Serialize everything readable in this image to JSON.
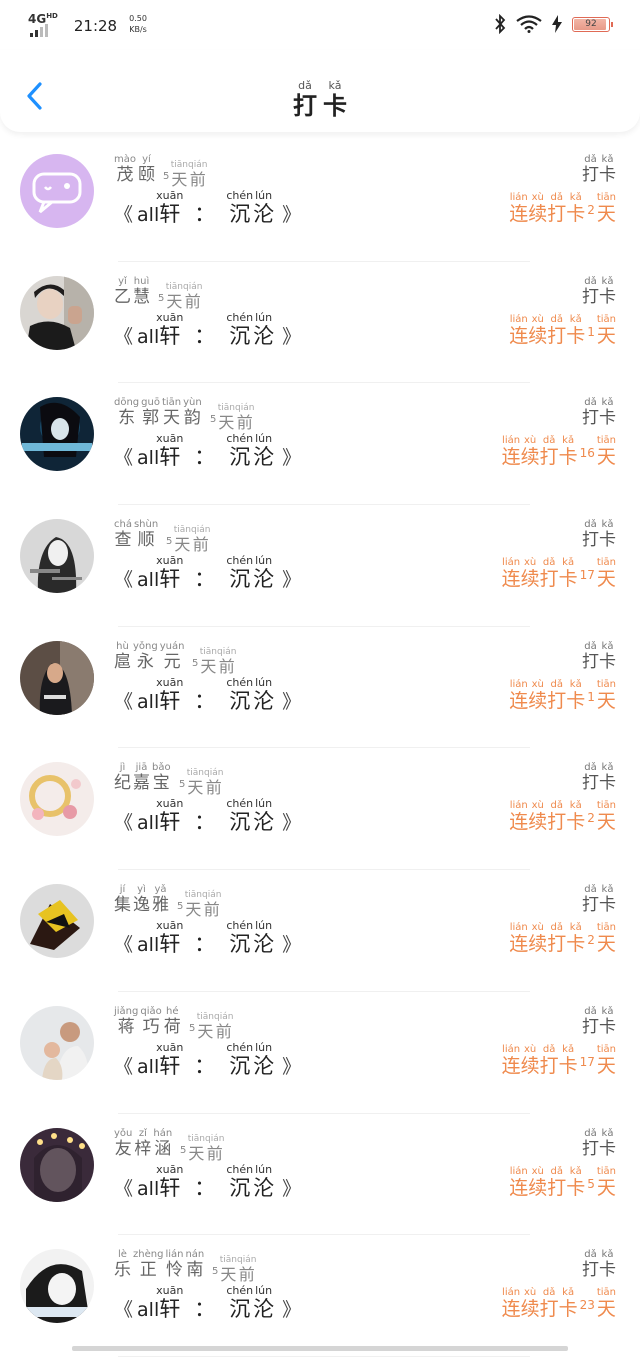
{
  "status_bar": {
    "network": "4G",
    "network_sup": "HD",
    "time": "21:28",
    "speed_value": "0.50",
    "speed_unit": "KB/s",
    "battery": "92"
  },
  "header": {
    "title": [
      {
        "char": "打",
        "pinyin": "dǎ"
      },
      {
        "char": "卡",
        "pinyin": "kǎ"
      }
    ],
    "icons": {
      "back": "chevron-left-icon"
    }
  },
  "rows": [
    {
      "avatar": "speech-bubble",
      "name": [
        {
          "char": "茂",
          "pinyin": "mào"
        },
        {
          "char": "颐",
          "pinyin": "yí"
        }
      ],
      "days": "5",
      "streak": "2"
    },
    {
      "avatar": "photo-man",
      "name": [
        {
          "char": "乙",
          "pinyin": "yǐ"
        },
        {
          "char": "慧",
          "pinyin": "huì"
        }
      ],
      "days": "5",
      "streak": "1"
    },
    {
      "avatar": "photo-anime",
      "name": [
        {
          "char": "东",
          "pinyin": "dōng"
        },
        {
          "char": "郭",
          "pinyin": "guō"
        },
        {
          "char": "天",
          "pinyin": "tiān"
        },
        {
          "char": "韵",
          "pinyin": "yùn"
        }
      ],
      "days": "5",
      "streak": "16"
    },
    {
      "avatar": "photo-girl-bw",
      "name": [
        {
          "char": "查",
          "pinyin": "chá"
        },
        {
          "char": "顺",
          "pinyin": "shùn"
        }
      ],
      "days": "5",
      "streak": "17"
    },
    {
      "avatar": "photo-girl-dark",
      "name": [
        {
          "char": "扈",
          "pinyin": "hù"
        },
        {
          "char": "永",
          "pinyin": "yǒng"
        },
        {
          "char": "元",
          "pinyin": "yuán"
        }
      ],
      "days": "5",
      "streak": "1"
    },
    {
      "avatar": "photo-bracelet",
      "name": [
        {
          "char": "纪",
          "pinyin": "jì"
        },
        {
          "char": "嘉",
          "pinyin": "jiā"
        },
        {
          "char": "宝",
          "pinyin": "bǎo"
        }
      ],
      "days": "5",
      "streak": "2"
    },
    {
      "avatar": "photo-gold",
      "name": [
        {
          "char": "集",
          "pinyin": "jí"
        },
        {
          "char": "逸",
          "pinyin": "yì"
        },
        {
          "char": "雅",
          "pinyin": "yǎ"
        }
      ],
      "days": "5",
      "streak": "2"
    },
    {
      "avatar": "photo-family",
      "name": [
        {
          "char": "蒋",
          "pinyin": "jiǎng"
        },
        {
          "char": "巧",
          "pinyin": "qiǎo"
        },
        {
          "char": "荷",
          "pinyin": "hé"
        }
      ],
      "days": "5",
      "streak": "17"
    },
    {
      "avatar": "photo-girl-lights",
      "name": [
        {
          "char": "友",
          "pinyin": "yǒu"
        },
        {
          "char": "梓",
          "pinyin": "zǐ"
        },
        {
          "char": "涵",
          "pinyin": "hán"
        }
      ],
      "days": "5",
      "streak": "5"
    },
    {
      "avatar": "photo-girl-sketch",
      "name": [
        {
          "char": "乐",
          "pinyin": "lè"
        },
        {
          "char": "正",
          "pinyin": "zhèng"
        },
        {
          "char": "怜",
          "pinyin": "lián"
        },
        {
          "char": "南",
          "pinyin": "nán"
        }
      ],
      "days": "5",
      "streak": "23"
    }
  ],
  "row_common": {
    "time_suffix": [
      {
        "char": "天",
        "pinyin": "tiān"
      },
      {
        "char": "前",
        "pinyin": "qián"
      }
    ],
    "book": {
      "open": "《",
      "close": "》",
      "en": "all",
      "part1": [
        {
          "char": "轩",
          "pinyin": "xuān"
        }
      ],
      "colon": "：",
      "part2": [
        {
          "char": "沉",
          "pinyin": "chén"
        },
        {
          "char": "沦",
          "pinyin": "lún"
        }
      ]
    },
    "checkin": [
      {
        "char": "打",
        "pinyin": "dǎ"
      },
      {
        "char": "卡",
        "pinyin": "kǎ"
      }
    ],
    "streak_prefix": [
      {
        "char": "连",
        "pinyin": "lián"
      },
      {
        "char": "续",
        "pinyin": "xù"
      },
      {
        "char": "打",
        "pinyin": "dǎ"
      },
      {
        "char": "卡",
        "pinyin": "kǎ"
      }
    ],
    "streak_suffix": [
      {
        "char": "天",
        "pinyin": "tiān"
      }
    ]
  },
  "colors": {
    "accent": "#ef8a4d",
    "back": "#1e90ff"
  }
}
